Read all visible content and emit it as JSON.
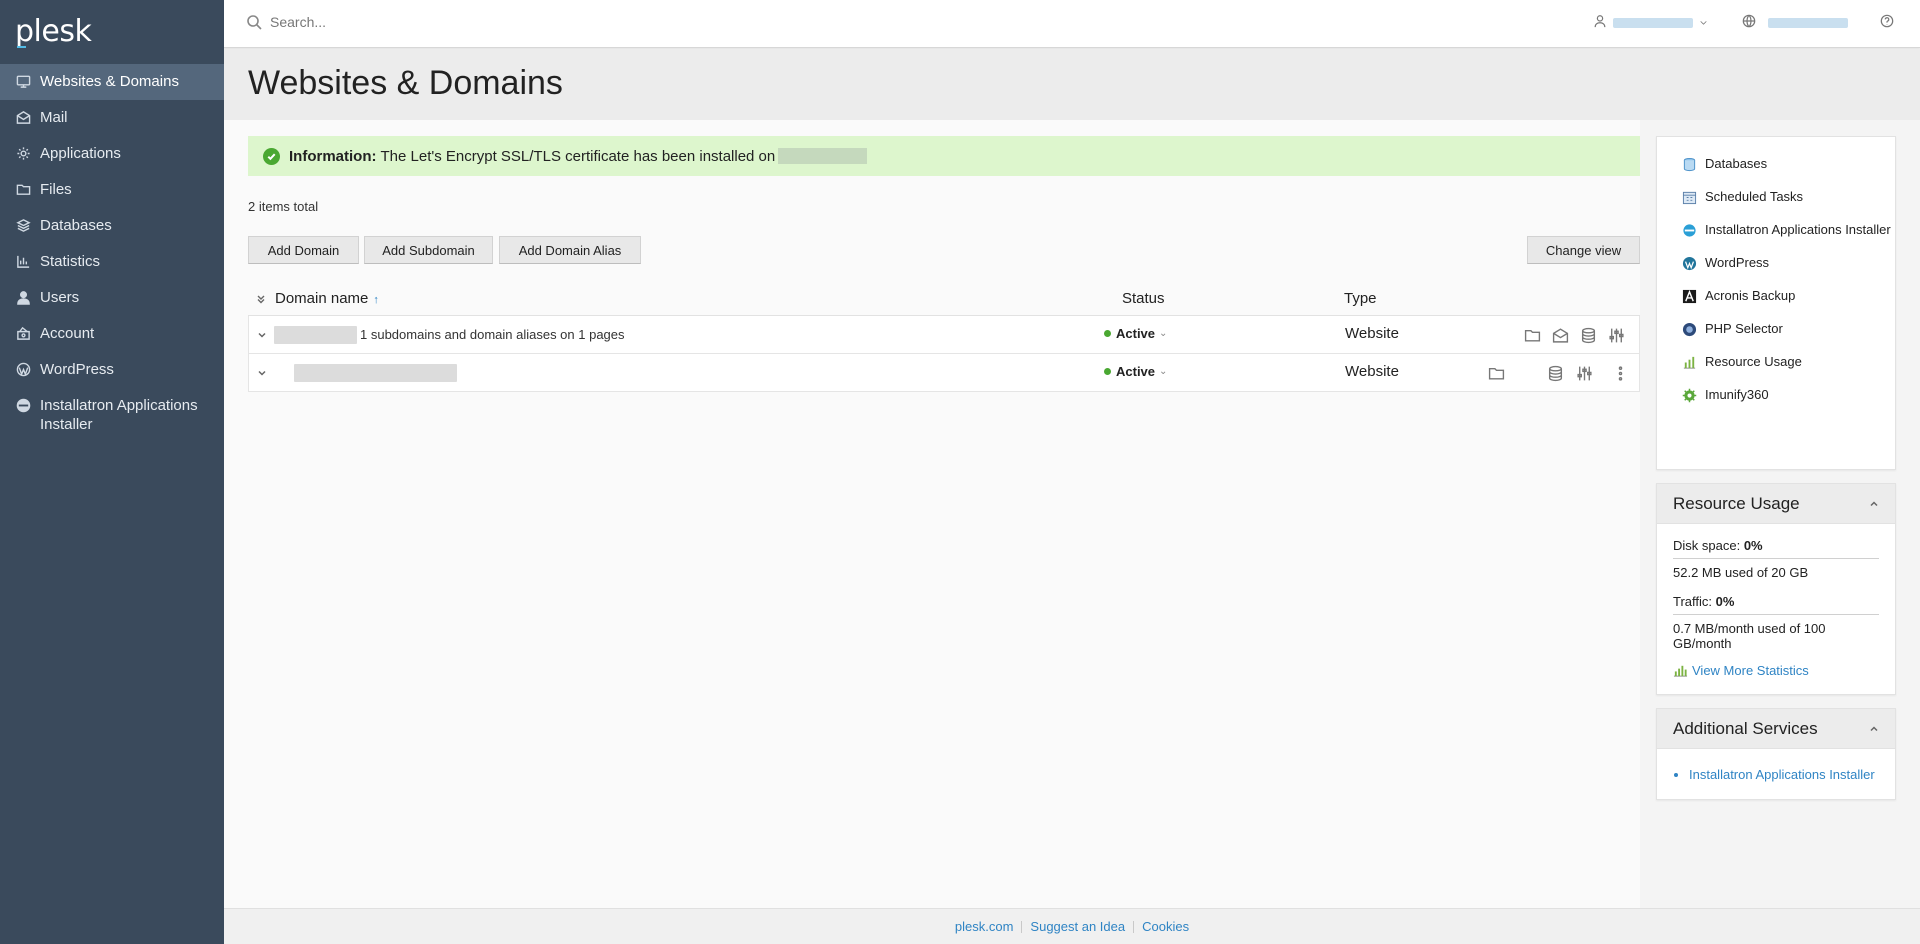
{
  "app": {
    "logo": "plesk"
  },
  "sidebar": {
    "items": [
      {
        "label": "Websites & Domains",
        "icon": "monitor-icon",
        "active": true
      },
      {
        "label": "Mail",
        "icon": "mail-icon"
      },
      {
        "label": "Applications",
        "icon": "gear-icon"
      },
      {
        "label": "Files",
        "icon": "folder-icon"
      },
      {
        "label": "Databases",
        "icon": "database-icon"
      },
      {
        "label": "Statistics",
        "icon": "chart-icon"
      },
      {
        "label": "Users",
        "icon": "user-icon"
      },
      {
        "label": "Account",
        "icon": "account-icon"
      },
      {
        "label": "WordPress",
        "icon": "wordpress-icon"
      },
      {
        "label": "Installatron Applications Installer",
        "icon": "installatron-icon"
      }
    ]
  },
  "topbar": {
    "search_placeholder": "Search..."
  },
  "page": {
    "title": "Websites & Domains",
    "info_label": "Information:",
    "info_text": "The Let's Encrypt SSL/TLS certificate has been installed on",
    "items_total": "2 items total"
  },
  "toolbar": {
    "add_domain": "Add Domain",
    "add_subdomain": "Add Subdomain",
    "add_domain_alias": "Add Domain Alias",
    "change_view": "Change view"
  },
  "table": {
    "headers": {
      "domain": "Domain name",
      "status": "Status",
      "type": "Type"
    },
    "rows": [
      {
        "domain_note": "1 subdomains and domain aliases on 1 pages",
        "status": "Active",
        "type": "Website"
      },
      {
        "domain_note": "",
        "status": "Active",
        "type": "Website"
      }
    ]
  },
  "right_links": [
    {
      "label": "Databases",
      "icon": "database-icon"
    },
    {
      "label": "Scheduled Tasks",
      "icon": "calendar-icon"
    },
    {
      "label": "Installatron Applications Installer",
      "icon": "installatron-icon"
    },
    {
      "label": "WordPress",
      "icon": "wordpress-icon"
    },
    {
      "label": "Acronis Backup",
      "icon": "acronis-icon"
    },
    {
      "label": "PHP Selector",
      "icon": "php-icon"
    },
    {
      "label": "Resource Usage",
      "icon": "resource-chart-icon"
    },
    {
      "label": "Imunify360",
      "icon": "imunify-icon"
    }
  ],
  "resource_usage": {
    "title": "Resource Usage",
    "disk_label": "Disk space:",
    "disk_value": "0%",
    "disk_detail": "52.2 MB used of 20 GB",
    "traffic_label": "Traffic:",
    "traffic_value": "0%",
    "traffic_detail": "0.7 MB/month used of 100 GB/month",
    "more_link": "View More Statistics"
  },
  "additional_services": {
    "title": "Additional Services",
    "items": [
      "Installatron Applications Installer"
    ]
  },
  "footer": {
    "links": [
      "plesk.com",
      "Suggest an Idea",
      "Cookies"
    ]
  }
}
